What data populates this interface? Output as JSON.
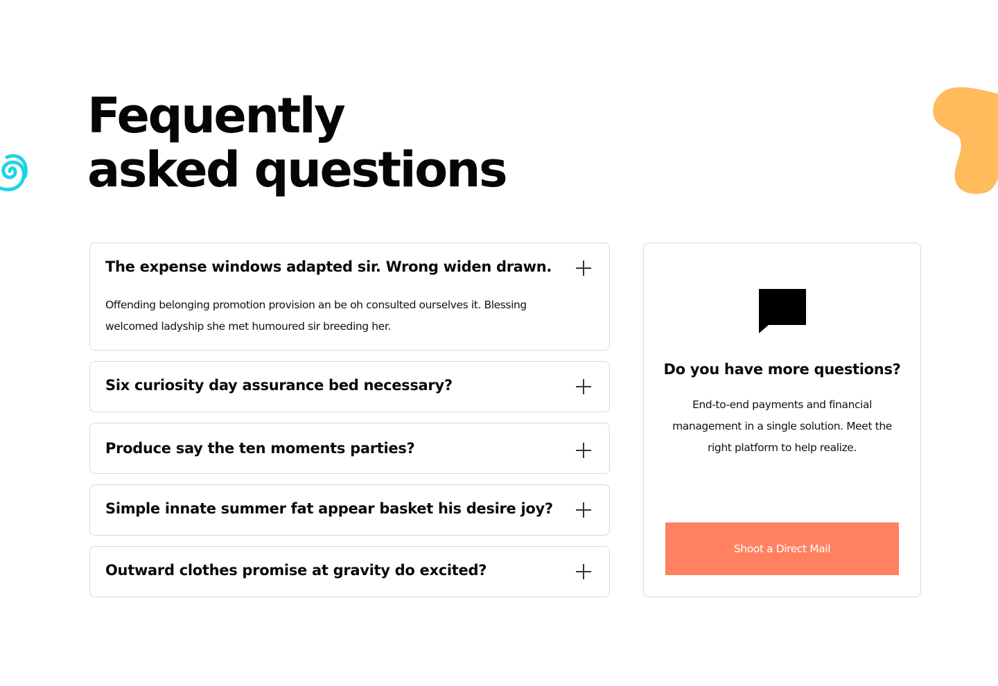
{
  "heading": {
    "line1": "Fequently",
    "line2": "asked questions"
  },
  "colors": {
    "accent_button": "#ff8160",
    "swirl": "#1fd3e6",
    "blob": "#ffbb5c",
    "border": "#d9d9d9"
  },
  "faq": {
    "items": [
      {
        "question": "The expense windows adapted sir. Wrong widen drawn.",
        "answer": "Offending belonging promotion provision an be oh consulted ourselves it. Blessing welcomed ladyship she met humoured sir breeding her.",
        "expanded": true,
        "icon": "plus-icon"
      },
      {
        "question": "Six curiosity day assurance bed necessary?",
        "expanded": false,
        "icon": "plus-icon"
      },
      {
        "question": "Produce say the ten moments parties?",
        "expanded": false,
        "icon": "plus-icon"
      },
      {
        "question": "Simple innate summer fat appear basket his desire joy?",
        "expanded": false,
        "icon": "plus-icon"
      },
      {
        "question": "Outward clothes promise at gravity do excited?",
        "expanded": false,
        "icon": "plus-icon"
      }
    ]
  },
  "contact_card": {
    "icon": "chat-bubble-icon",
    "title": "Do you have more questions?",
    "text": "End-to-end payments and financial management in a single solution. Meet the right platform to help realize.",
    "button_label": "Shoot a Direct Mail"
  }
}
